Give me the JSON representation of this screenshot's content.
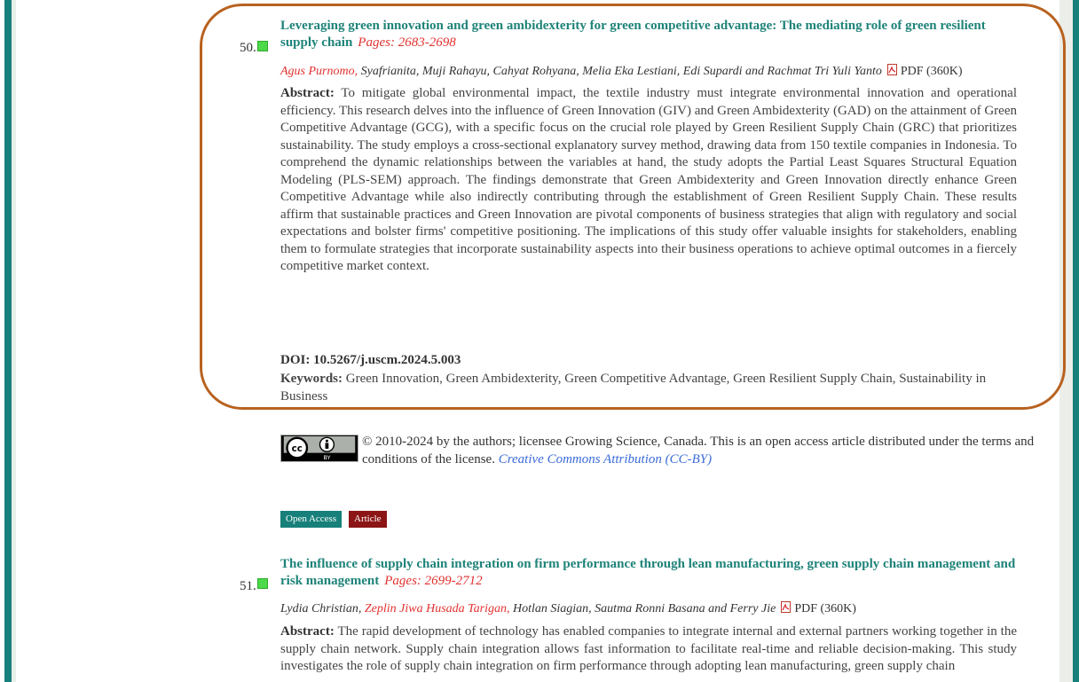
{
  "articles": [
    {
      "number": "50.",
      "title": "Leveraging green innovation and green ambidexterity for green competitive advantage: The mediating role of green resilient supply chain",
      "pages": "Pages: 2683-2698",
      "lead_author": "Agus Purnomo,",
      "other_authors": "Syafrianita, Muji Rahayu, Cahyat Rohyana, Melia Eka Lestiani, Edi Supardi and Rachmat Tri Yuli Yanto",
      "pdf": "PDF (360K)",
      "abstract_label": "Abstract:",
      "abstract": "To mitigate global environmental impact, the textile industry must integrate environmental innovation and operational efficiency. This research delves into the influence of Green Innovation (GIV) and Green Ambidexterity (GAD) on the attainment of Green Competitive Advantage (GCG), with a specific focus on the crucial role played by Green Resilient Supply Chain (GRC) that prioritizes sustainability. The study employs a cross-sectional explanatory survey method, drawing data from 150 textile companies in Indonesia. To comprehend the dynamic relationships between the variables at hand, the study adopts the Partial Least Squares Structural Equation Modeling (PLS-SEM) approach. The findings demonstrate that Green Ambidexterity and Green Innovation directly enhance Green Competitive Advantage while also indirectly contributing through the establishment of Green Resilient Supply Chain. These results affirm that sustainable practices and Green Innovation are pivotal components of business strategies that align with regulatory and social expectations and bolster firms' competitive positioning. The implications of this study offer valuable insights for stakeholders, enabling them to formulate strategies that incorporate sustainability aspects into their business operations to achieve optimal outcomes in a fiercely competitive market context.",
      "doi": "DOI: 10.5267/j.uscm.2024.5.003",
      "keywords_label": "Keywords:",
      "keywords": "Green Innovation, Green Ambidexterity, Green Competitive Advantage, Green Resilient Supply Chain, Sustainability in Business"
    },
    {
      "number": "51.",
      "title": "The influence of supply chain integration on firm performance through lean manufacturing, green supply chain management and risk management",
      "pages": "Pages: 2699-2712",
      "lead_author": "Lydia Christian,",
      "second_author": "Zeplin Jiwa Husada Tarigan,",
      "other_authors": "Hotlan Siagian, Sautma Ronni Basana and Ferry Jie",
      "pdf": "PDF (360K)",
      "abstract_label": "Abstract:",
      "abstract": "The rapid development of technology has enabled companies to integrate internal and external partners working together in the supply chain network. Supply chain integration allows fast information to facilitate real-time and reliable decision-making. This study investigates the role of supply chain integration on firm performance through adopting lean manufacturing, green supply chain"
    }
  ],
  "license": {
    "text": "© 2010-2024 by the authors; licensee Growing Science, Canada. This is an open access article distributed under the terms and conditions of the license.",
    "link": "Creative Commons Attribution (CC-BY)",
    "badge_cc": "cc",
    "badge_by": "BY"
  },
  "tags": {
    "open_access": "Open Access",
    "article": "Article"
  },
  "colors": {
    "frame": "#17807a",
    "title": "#1e8379",
    "pages": "#e1322f",
    "marker": "#4cd94a",
    "highlight": "#b8621f",
    "article_tag": "#8c1515"
  }
}
